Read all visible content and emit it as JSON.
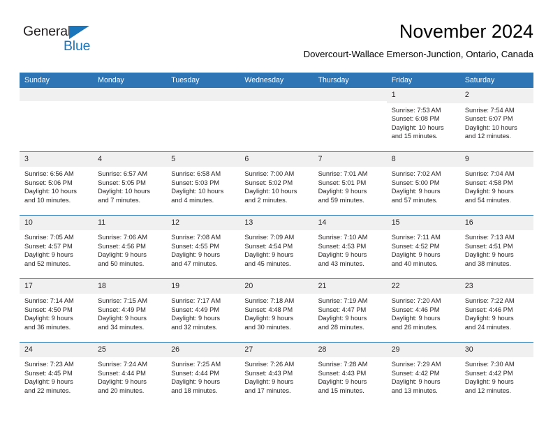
{
  "brand": {
    "line1": "General",
    "line2": "Blue",
    "triangle_color": "#1b75bb",
    "text_color": "#231f20"
  },
  "header": {
    "title": "November 2024",
    "subtitle": "Dovercourt-Wallace Emerson-Junction, Ontario, Canada"
  },
  "theme": {
    "header_blue": "#2e75b6",
    "daynum_band": "#f0f0f0",
    "text": "#231f20",
    "page_background": "#ffffff"
  },
  "calendar": {
    "weekday_headers": [
      "Sunday",
      "Monday",
      "Tuesday",
      "Wednesday",
      "Thursday",
      "Friday",
      "Saturday"
    ],
    "labels": {
      "sunrise": "Sunrise:",
      "sunset": "Sunset:",
      "daylight": "Daylight:"
    },
    "weeks": [
      [
        {
          "day": "",
          "sunrise": "",
          "sunset": "",
          "daylight_line1": "",
          "daylight_line2": ""
        },
        {
          "day": "",
          "sunrise": "",
          "sunset": "",
          "daylight_line1": "",
          "daylight_line2": ""
        },
        {
          "day": "",
          "sunrise": "",
          "sunset": "",
          "daylight_line1": "",
          "daylight_line2": ""
        },
        {
          "day": "",
          "sunrise": "",
          "sunset": "",
          "daylight_line1": "",
          "daylight_line2": ""
        },
        {
          "day": "",
          "sunrise": "",
          "sunset": "",
          "daylight_line1": "",
          "daylight_line2": ""
        },
        {
          "day": "1",
          "sunrise": "Sunrise: 7:53 AM",
          "sunset": "Sunset: 6:08 PM",
          "daylight_line1": "Daylight: 10 hours",
          "daylight_line2": "and 15 minutes."
        },
        {
          "day": "2",
          "sunrise": "Sunrise: 7:54 AM",
          "sunset": "Sunset: 6:07 PM",
          "daylight_line1": "Daylight: 10 hours",
          "daylight_line2": "and 12 minutes."
        }
      ],
      [
        {
          "day": "3",
          "sunrise": "Sunrise: 6:56 AM",
          "sunset": "Sunset: 5:06 PM",
          "daylight_line1": "Daylight: 10 hours",
          "daylight_line2": "and 10 minutes."
        },
        {
          "day": "4",
          "sunrise": "Sunrise: 6:57 AM",
          "sunset": "Sunset: 5:05 PM",
          "daylight_line1": "Daylight: 10 hours",
          "daylight_line2": "and 7 minutes."
        },
        {
          "day": "5",
          "sunrise": "Sunrise: 6:58 AM",
          "sunset": "Sunset: 5:03 PM",
          "daylight_line1": "Daylight: 10 hours",
          "daylight_line2": "and 4 minutes."
        },
        {
          "day": "6",
          "sunrise": "Sunrise: 7:00 AM",
          "sunset": "Sunset: 5:02 PM",
          "daylight_line1": "Daylight: 10 hours",
          "daylight_line2": "and 2 minutes."
        },
        {
          "day": "7",
          "sunrise": "Sunrise: 7:01 AM",
          "sunset": "Sunset: 5:01 PM",
          "daylight_line1": "Daylight: 9 hours",
          "daylight_line2": "and 59 minutes."
        },
        {
          "day": "8",
          "sunrise": "Sunrise: 7:02 AM",
          "sunset": "Sunset: 5:00 PM",
          "daylight_line1": "Daylight: 9 hours",
          "daylight_line2": "and 57 minutes."
        },
        {
          "day": "9",
          "sunrise": "Sunrise: 7:04 AM",
          "sunset": "Sunset: 4:58 PM",
          "daylight_line1": "Daylight: 9 hours",
          "daylight_line2": "and 54 minutes."
        }
      ],
      [
        {
          "day": "10",
          "sunrise": "Sunrise: 7:05 AM",
          "sunset": "Sunset: 4:57 PM",
          "daylight_line1": "Daylight: 9 hours",
          "daylight_line2": "and 52 minutes."
        },
        {
          "day": "11",
          "sunrise": "Sunrise: 7:06 AM",
          "sunset": "Sunset: 4:56 PM",
          "daylight_line1": "Daylight: 9 hours",
          "daylight_line2": "and 50 minutes."
        },
        {
          "day": "12",
          "sunrise": "Sunrise: 7:08 AM",
          "sunset": "Sunset: 4:55 PM",
          "daylight_line1": "Daylight: 9 hours",
          "daylight_line2": "and 47 minutes."
        },
        {
          "day": "13",
          "sunrise": "Sunrise: 7:09 AM",
          "sunset": "Sunset: 4:54 PM",
          "daylight_line1": "Daylight: 9 hours",
          "daylight_line2": "and 45 minutes."
        },
        {
          "day": "14",
          "sunrise": "Sunrise: 7:10 AM",
          "sunset": "Sunset: 4:53 PM",
          "daylight_line1": "Daylight: 9 hours",
          "daylight_line2": "and 43 minutes."
        },
        {
          "day": "15",
          "sunrise": "Sunrise: 7:11 AM",
          "sunset": "Sunset: 4:52 PM",
          "daylight_line1": "Daylight: 9 hours",
          "daylight_line2": "and 40 minutes."
        },
        {
          "day": "16",
          "sunrise": "Sunrise: 7:13 AM",
          "sunset": "Sunset: 4:51 PM",
          "daylight_line1": "Daylight: 9 hours",
          "daylight_line2": "and 38 minutes."
        }
      ],
      [
        {
          "day": "17",
          "sunrise": "Sunrise: 7:14 AM",
          "sunset": "Sunset: 4:50 PM",
          "daylight_line1": "Daylight: 9 hours",
          "daylight_line2": "and 36 minutes."
        },
        {
          "day": "18",
          "sunrise": "Sunrise: 7:15 AM",
          "sunset": "Sunset: 4:49 PM",
          "daylight_line1": "Daylight: 9 hours",
          "daylight_line2": "and 34 minutes."
        },
        {
          "day": "19",
          "sunrise": "Sunrise: 7:17 AM",
          "sunset": "Sunset: 4:49 PM",
          "daylight_line1": "Daylight: 9 hours",
          "daylight_line2": "and 32 minutes."
        },
        {
          "day": "20",
          "sunrise": "Sunrise: 7:18 AM",
          "sunset": "Sunset: 4:48 PM",
          "daylight_line1": "Daylight: 9 hours",
          "daylight_line2": "and 30 minutes."
        },
        {
          "day": "21",
          "sunrise": "Sunrise: 7:19 AM",
          "sunset": "Sunset: 4:47 PM",
          "daylight_line1": "Daylight: 9 hours",
          "daylight_line2": "and 28 minutes."
        },
        {
          "day": "22",
          "sunrise": "Sunrise: 7:20 AM",
          "sunset": "Sunset: 4:46 PM",
          "daylight_line1": "Daylight: 9 hours",
          "daylight_line2": "and 26 minutes."
        },
        {
          "day": "23",
          "sunrise": "Sunrise: 7:22 AM",
          "sunset": "Sunset: 4:46 PM",
          "daylight_line1": "Daylight: 9 hours",
          "daylight_line2": "and 24 minutes."
        }
      ],
      [
        {
          "day": "24",
          "sunrise": "Sunrise: 7:23 AM",
          "sunset": "Sunset: 4:45 PM",
          "daylight_line1": "Daylight: 9 hours",
          "daylight_line2": "and 22 minutes."
        },
        {
          "day": "25",
          "sunrise": "Sunrise: 7:24 AM",
          "sunset": "Sunset: 4:44 PM",
          "daylight_line1": "Daylight: 9 hours",
          "daylight_line2": "and 20 minutes."
        },
        {
          "day": "26",
          "sunrise": "Sunrise: 7:25 AM",
          "sunset": "Sunset: 4:44 PM",
          "daylight_line1": "Daylight: 9 hours",
          "daylight_line2": "and 18 minutes."
        },
        {
          "day": "27",
          "sunrise": "Sunrise: 7:26 AM",
          "sunset": "Sunset: 4:43 PM",
          "daylight_line1": "Daylight: 9 hours",
          "daylight_line2": "and 17 minutes."
        },
        {
          "day": "28",
          "sunrise": "Sunrise: 7:28 AM",
          "sunset": "Sunset: 4:43 PM",
          "daylight_line1": "Daylight: 9 hours",
          "daylight_line2": "and 15 minutes."
        },
        {
          "day": "29",
          "sunrise": "Sunrise: 7:29 AM",
          "sunset": "Sunset: 4:42 PM",
          "daylight_line1": "Daylight: 9 hours",
          "daylight_line2": "and 13 minutes."
        },
        {
          "day": "30",
          "sunrise": "Sunrise: 7:30 AM",
          "sunset": "Sunset: 4:42 PM",
          "daylight_line1": "Daylight: 9 hours",
          "daylight_line2": "and 12 minutes."
        }
      ]
    ]
  }
}
